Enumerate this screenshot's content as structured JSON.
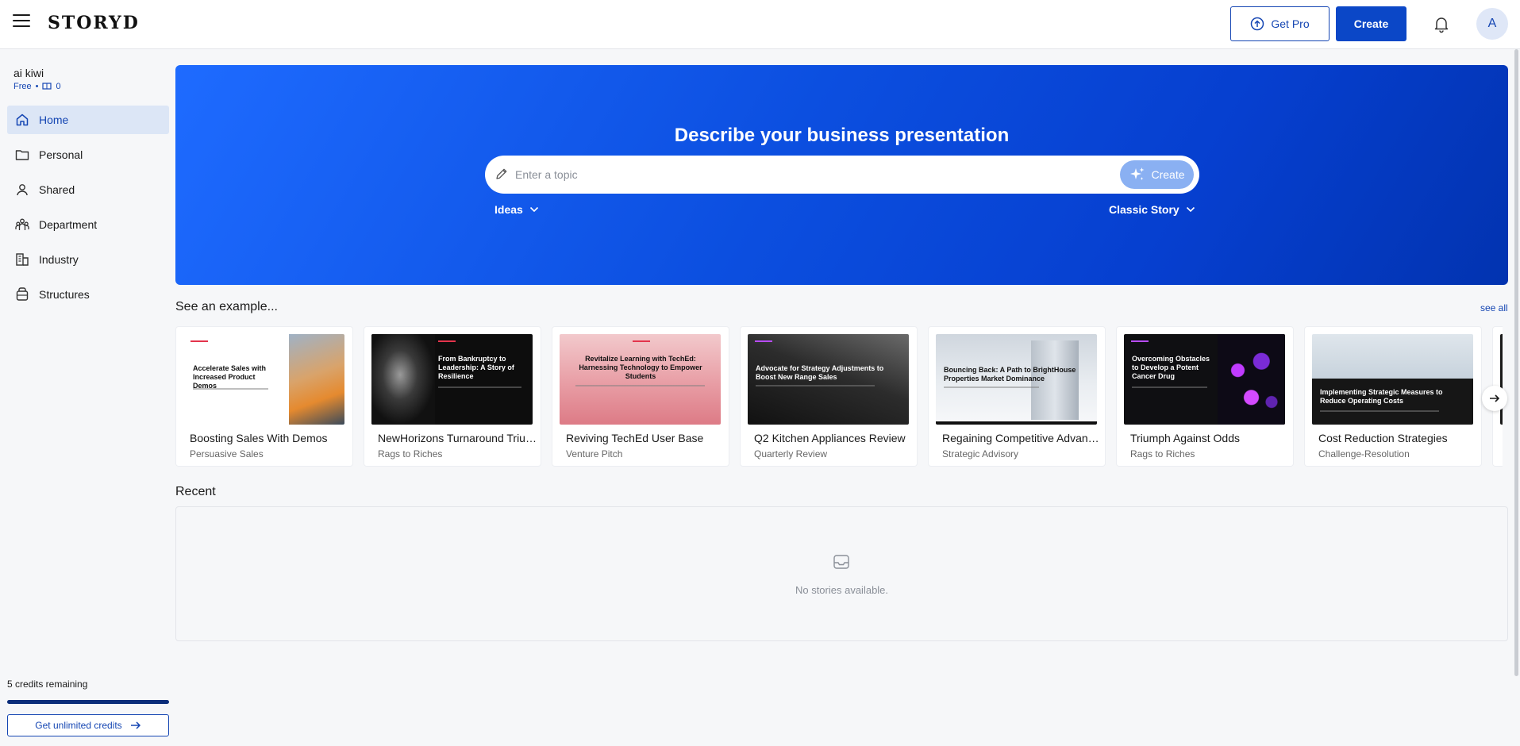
{
  "header": {
    "brand": "STORYD",
    "get_pro_label": "Get Pro",
    "create_label": "Create",
    "avatar_initial": "A"
  },
  "sidebar": {
    "user_name": "ai kiwi",
    "plan": "Free",
    "separator": "•",
    "presentations_count": "0",
    "items": [
      {
        "label": "Home",
        "icon": "home-icon",
        "active": true
      },
      {
        "label": "Personal",
        "icon": "folder-icon",
        "active": false
      },
      {
        "label": "Shared",
        "icon": "person-icon",
        "active": false
      },
      {
        "label": "Department",
        "icon": "group-icon",
        "active": false
      },
      {
        "label": "Industry",
        "icon": "building-icon",
        "active": false
      },
      {
        "label": "Structures",
        "icon": "structure-icon",
        "active": false
      }
    ],
    "credits_text": "5 credits remaining",
    "credits_progress": 1.0,
    "unlimited_label": "Get unlimited credits"
  },
  "hero": {
    "title": "Describe your business presentation",
    "placeholder": "Enter a topic",
    "create_label": "Create",
    "ideas_label": "Ideas",
    "style_label": "Classic Story"
  },
  "examples": {
    "title": "See an example...",
    "see_all": "see all",
    "cards": [
      {
        "title": "Boosting Sales With Demos",
        "subtitle": "Persuasive Sales",
        "thumb_title": "Accelerate Sales with Increased Product Demos"
      },
      {
        "title": "NewHorizons Turnaround Triumph",
        "subtitle": "Rags to Riches",
        "thumb_title": "From Bankruptcy to Leadership: A Story of Resilience"
      },
      {
        "title": "Reviving TechEd User Base",
        "subtitle": "Venture Pitch",
        "thumb_title": "Revitalize Learning with TechEd: Harnessing Technology to Empower Students"
      },
      {
        "title": "Q2 Kitchen Appliances Review",
        "subtitle": "Quarterly Review",
        "thumb_title": "Advocate for Strategy Adjustments to Boost New Range Sales"
      },
      {
        "title": "Regaining Competitive Advantage",
        "subtitle": "Strategic Advisory",
        "thumb_title": "Bouncing Back: A Path to BrightHouse Properties Market Dominance"
      },
      {
        "title": "Triumph Against Odds",
        "subtitle": "Rags to Riches",
        "thumb_title": "Overcoming Obstacles to Develop a Potent Cancer Drug"
      },
      {
        "title": "Cost Reduction Strategies",
        "subtitle": "Challenge-Resolution",
        "thumb_title": "Implementing Strategic Measures to Reduce Operating Costs"
      }
    ]
  },
  "recent": {
    "title": "Recent",
    "empty_text": "No stories available."
  },
  "colors": {
    "accent": "#0b47c7",
    "hero_gradient_start": "#1e6bff",
    "hero_gradient_end": "#0233b0",
    "active_nav": "#dce6f6"
  }
}
